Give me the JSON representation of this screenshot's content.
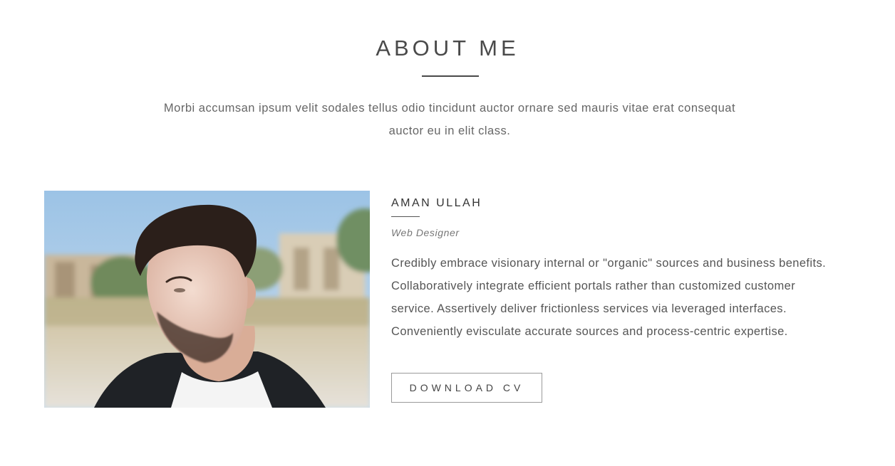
{
  "about": {
    "title": "ABOUT ME",
    "intro": "Morbi accumsan ipsum velit sodales tellus odio tincidunt auctor ornare sed mauris vitae erat consequat auctor eu in elit class."
  },
  "profile": {
    "name": "AMAN ULLAH",
    "role": "Web Designer",
    "description": "Credibly embrace visionary internal or \"organic\" sources and business benefits. Collaboratively integrate efficient portals rather than customized customer service. Assertively deliver frictionless services via leveraged interfaces. Conveniently evisculate accurate sources and process-centric expertise.",
    "cv_button_label": "DOWNLOAD CV"
  },
  "colors": {
    "title": "#4a4a4a",
    "body_text": "#555555",
    "button_border": "#9a9a9a",
    "background": "#ffffff"
  }
}
